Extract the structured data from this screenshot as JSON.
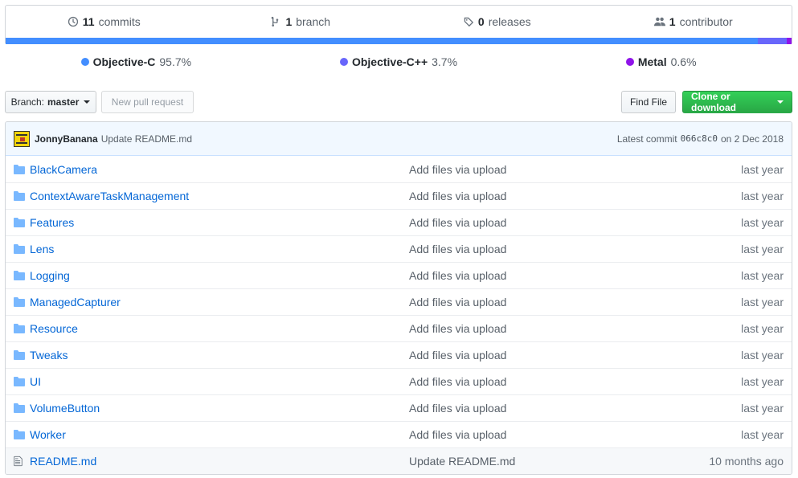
{
  "summary": {
    "commits_num": "11",
    "commits_label": "commits",
    "branch_num": "1",
    "branch_label": "branch",
    "releases_num": "0",
    "releases_label": "releases",
    "contributor_num": "1",
    "contributor_label": "contributor"
  },
  "languages": [
    {
      "name": "Objective-C",
      "percent": "95.7%",
      "color": "#438eff"
    },
    {
      "name": "Objective-C++",
      "percent": "3.7%",
      "color": "#6866fb"
    },
    {
      "name": "Metal",
      "percent": "0.6%",
      "color": "#8f14e9"
    }
  ],
  "toolbar": {
    "branch_label": "Branch:",
    "branch_value": "master",
    "new_pr": "New pull request",
    "find_file": "Find File",
    "clone": "Clone or download"
  },
  "commit": {
    "author": "JonnyBanana",
    "message": "Update README.md",
    "latest_label": "Latest commit",
    "sha": "066c8c0",
    "date": "on 2 Dec 2018"
  },
  "files": [
    {
      "name": "BlackCamera",
      "type": "folder",
      "message": "Add files via upload",
      "age": "last year"
    },
    {
      "name": "ContextAwareTaskManagement",
      "type": "folder",
      "message": "Add files via upload",
      "age": "last year"
    },
    {
      "name": "Features",
      "type": "folder",
      "message": "Add files via upload",
      "age": "last year"
    },
    {
      "name": "Lens",
      "type": "folder",
      "message": "Add files via upload",
      "age": "last year"
    },
    {
      "name": "Logging",
      "type": "folder",
      "message": "Add files via upload",
      "age": "last year"
    },
    {
      "name": "ManagedCapturer",
      "type": "folder",
      "message": "Add files via upload",
      "age": "last year"
    },
    {
      "name": "Resource",
      "type": "folder",
      "message": "Add files via upload",
      "age": "last year"
    },
    {
      "name": "Tweaks",
      "type": "folder",
      "message": "Add files via upload",
      "age": "last year"
    },
    {
      "name": "UI",
      "type": "folder",
      "message": "Add files via upload",
      "age": "last year"
    },
    {
      "name": "VolumeButton",
      "type": "folder",
      "message": "Add files via upload",
      "age": "last year"
    },
    {
      "name": "Worker",
      "type": "folder",
      "message": "Add files via upload",
      "age": "last year"
    },
    {
      "name": "README.md",
      "type": "file",
      "message": "Update README.md",
      "age": "10 months ago"
    }
  ]
}
